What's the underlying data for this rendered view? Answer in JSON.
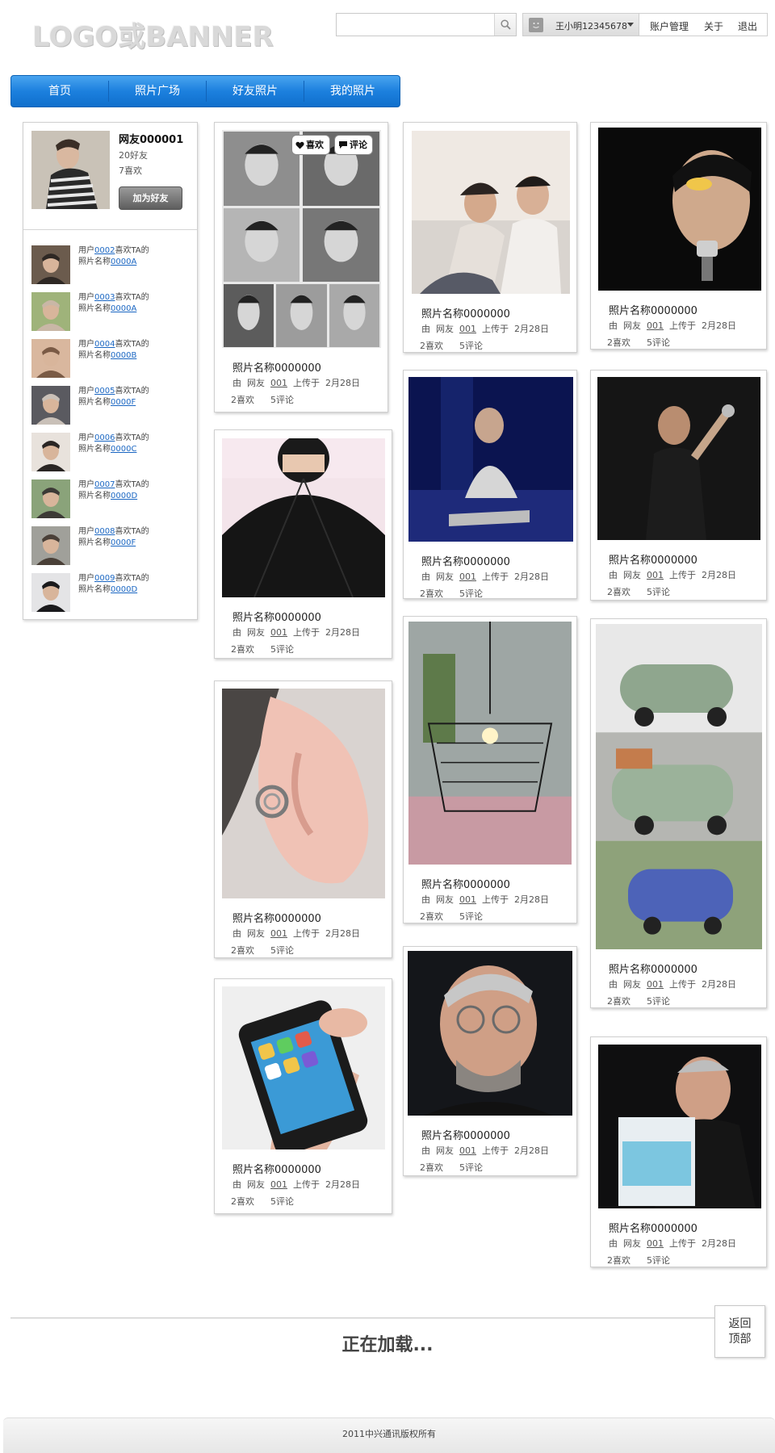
{
  "header": {
    "logo": "LOGO或BANNER",
    "search_placeholder": "",
    "user_name": "王小明12345678",
    "links": [
      "账户管理",
      "关于",
      "退出"
    ]
  },
  "nav": {
    "tabs": [
      "首页",
      "照片广场",
      "好友照片",
      "我的照片"
    ],
    "active": 0
  },
  "profile": {
    "name": "网友000001",
    "friends": "20好友",
    "likes": "7喜欢",
    "add_friend": "加为好友"
  },
  "activity": [
    {
      "prefix": "用户",
      "user": "0002",
      "mid": "喜欢TA的",
      "label": "照片名称",
      "photo": "0000A"
    },
    {
      "prefix": "用户",
      "user": "0003",
      "mid": "喜欢TA的",
      "label": "照片名称",
      "photo": "0000A"
    },
    {
      "prefix": "用户",
      "user": "0004",
      "mid": "喜欢TA的",
      "label": "照片名称",
      "photo": "0000B"
    },
    {
      "prefix": "用户",
      "user": "0005",
      "mid": "喜欢TA的",
      "label": "照片名称",
      "photo": "0000F"
    },
    {
      "prefix": "用户",
      "user": "0006",
      "mid": "喜欢TA的",
      "label": "照片名称",
      "photo": "0000C"
    },
    {
      "prefix": "用户",
      "user": "0007",
      "mid": "喜欢TA的",
      "label": "照片名称",
      "photo": "0000D"
    },
    {
      "prefix": "用户",
      "user": "0008",
      "mid": "喜欢TA的",
      "label": "照片名称",
      "photo": "0000F"
    },
    {
      "prefix": "用户",
      "user": "0009",
      "mid": "喜欢TA的",
      "label": "照片名称",
      "photo": "0000D"
    }
  ],
  "photo_card": {
    "title": "照片名称0000000",
    "by": "由",
    "by_user_prefix": "网友",
    "by_user": "001",
    "uploaded": "上传于",
    "date": "2月28日",
    "likes": "2喜欢",
    "comments": "5评论"
  },
  "overlay": {
    "like": "喜欢",
    "comment": "评论"
  },
  "loading": "正在加载...",
  "back_to_top": [
    "返回",
    "顶部"
  ],
  "footer": "2011中兴通讯版权所有"
}
